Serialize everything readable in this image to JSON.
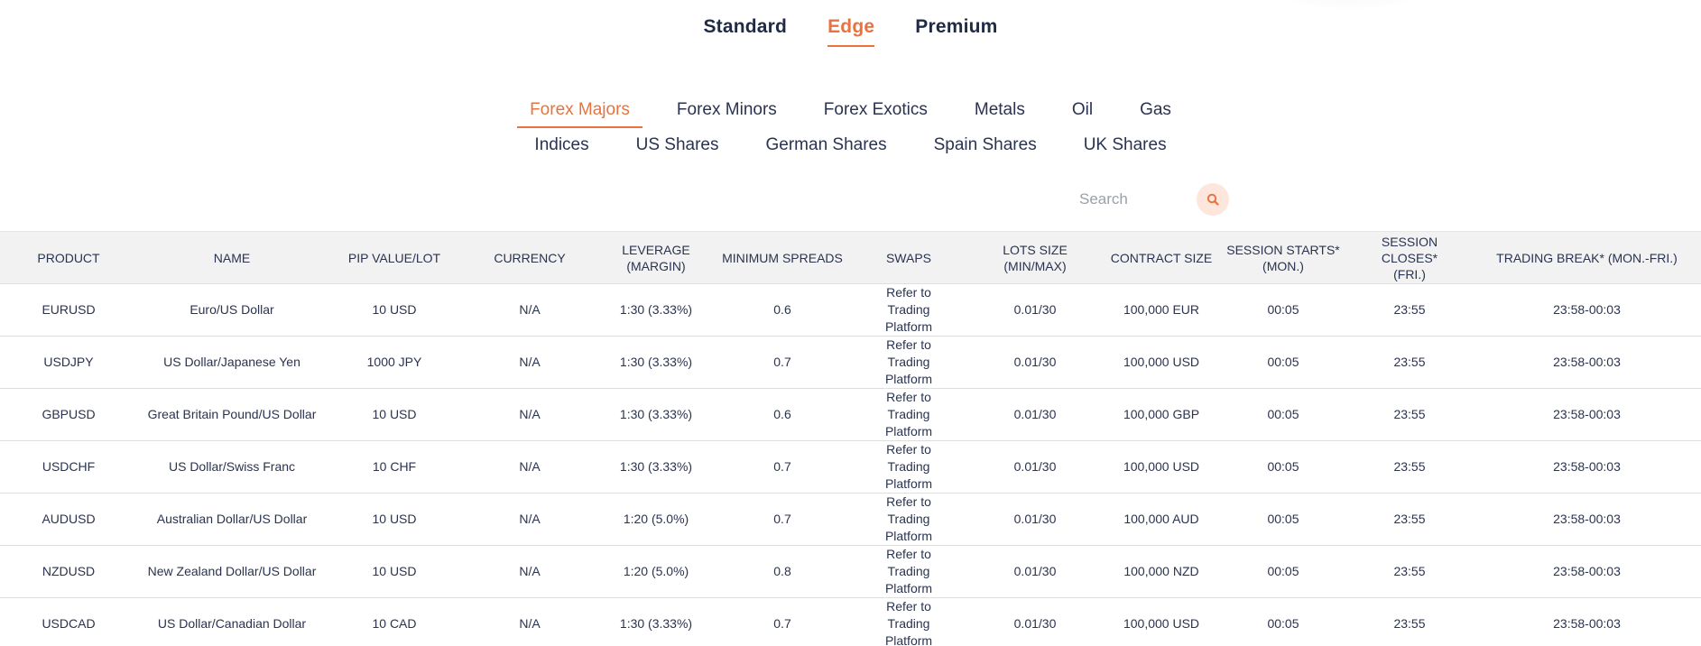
{
  "account_tabs": [
    {
      "label": "Standard",
      "active": false
    },
    {
      "label": "Edge",
      "active": true
    },
    {
      "label": "Premium",
      "active": false
    }
  ],
  "category_tabs": {
    "row1": [
      {
        "label": "Forex Majors",
        "active": true
      },
      {
        "label": "Forex Minors",
        "active": false
      },
      {
        "label": "Forex Exotics",
        "active": false
      },
      {
        "label": "Metals",
        "active": false
      },
      {
        "label": "Oil",
        "active": false
      },
      {
        "label": "Gas",
        "active": false
      }
    ],
    "row2": [
      {
        "label": "Indices",
        "active": false
      },
      {
        "label": "US Shares",
        "active": false
      },
      {
        "label": "German Shares",
        "active": false
      },
      {
        "label": "Spain Shares",
        "active": false
      },
      {
        "label": "UK Shares",
        "active": false
      }
    ]
  },
  "search": {
    "placeholder": "Search",
    "value": "",
    "icon": "search-icon"
  },
  "colors": {
    "accent": "#e8733f",
    "text": "#1f2a44",
    "header_bg": "#f2f2f2",
    "search_button_bg": "#fde7dc"
  },
  "table": {
    "headers": [
      "PRODUCT",
      "NAME",
      "PIP VALUE/LOT",
      "CURRENCY",
      "LEVERAGE\n(MARGIN)",
      "MINIMUM SPREADS",
      "SWAPS",
      "LOTS SIZE\n(MIN/MAX)",
      "CONTRACT SIZE",
      "SESSION STARTS*\n(MON.)",
      "SESSION CLOSES*\n(FRI.)",
      "TRADING BREAK* (MON.-FRI.)"
    ],
    "rows": [
      [
        "EURUSD",
        "Euro/US Dollar",
        "10 USD",
        "N/A",
        "1:30 (3.33%)",
        "0.6",
        "Refer to Trading Platform",
        "0.01/30",
        "100,000 EUR",
        "00:05",
        "23:55",
        "23:58-00:03"
      ],
      [
        "USDJPY",
        "US Dollar/Japanese Yen",
        "1000 JPY",
        "N/A",
        "1:30 (3.33%)",
        "0.7",
        "Refer to Trading Platform",
        "0.01/30",
        "100,000 USD",
        "00:05",
        "23:55",
        "23:58-00:03"
      ],
      [
        "GBPUSD",
        "Great Britain Pound/US Dollar",
        "10 USD",
        "N/A",
        "1:30 (3.33%)",
        "0.6",
        "Refer to Trading Platform",
        "0.01/30",
        "100,000 GBP",
        "00:05",
        "23:55",
        "23:58-00:03"
      ],
      [
        "USDCHF",
        "US Dollar/Swiss Franc",
        "10 CHF",
        "N/A",
        "1:30 (3.33%)",
        "0.7",
        "Refer to Trading Platform",
        "0.01/30",
        "100,000 USD",
        "00:05",
        "23:55",
        "23:58-00:03"
      ],
      [
        "AUDUSD",
        "Australian Dollar/US Dollar",
        "10 USD",
        "N/A",
        "1:20 (5.0%)",
        "0.7",
        "Refer to Trading Platform",
        "0.01/30",
        "100,000 AUD",
        "00:05",
        "23:55",
        "23:58-00:03"
      ],
      [
        "NZDUSD",
        "New Zealand Dollar/US Dollar",
        "10 USD",
        "N/A",
        "1:20 (5.0%)",
        "0.8",
        "Refer to Trading Platform",
        "0.01/30",
        "100,000 NZD",
        "00:05",
        "23:55",
        "23:58-00:03"
      ],
      [
        "USDCAD",
        "US Dollar/Canadian Dollar",
        "10 CAD",
        "N/A",
        "1:30 (3.33%)",
        "0.7",
        "Refer to Trading Platform",
        "0.01/30",
        "100,000 USD",
        "00:05",
        "23:55",
        "23:58-00:03"
      ]
    ]
  }
}
